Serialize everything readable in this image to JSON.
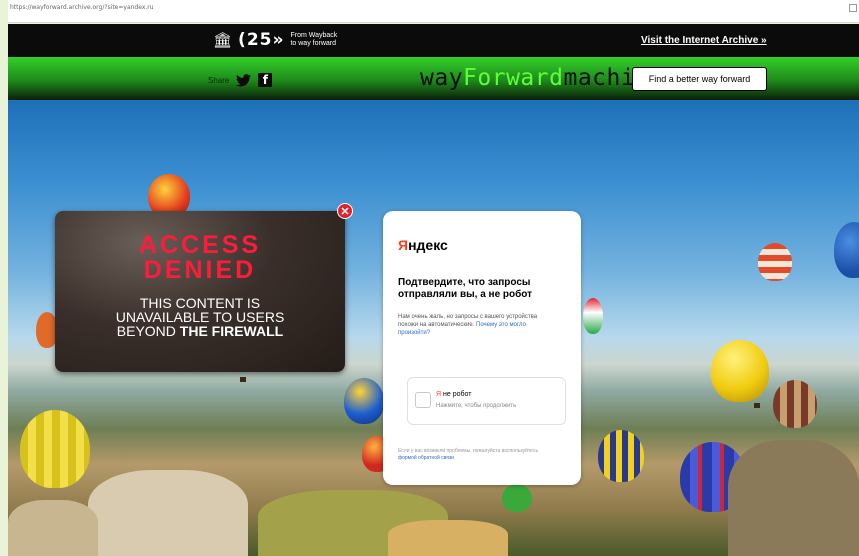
{
  "browser": {
    "url": "https://wayforward.archive.org/?site=yandex.ru"
  },
  "topbar": {
    "ia_glyph": "🏛",
    "anniversary": "(25»",
    "tagline_line1": "From Wayback",
    "tagline_line2": "to way forward",
    "visit_link": "Visit the Internet Archive »"
  },
  "greenbar": {
    "share_label": "Share",
    "twitter_icon": "twitter-icon",
    "facebook_glyph": "f",
    "logo_part1": "way",
    "logo_part2": "Forward",
    "logo_part3": "machine",
    "find_button": "Find a better way forward"
  },
  "popup": {
    "title_line1": "ACCESS",
    "title_line2": "DENIED",
    "msg_line1": "THIS CONTENT IS",
    "msg_line2": "UNAVAILABLE TO USERS",
    "msg_line3_prefix": "BEYOND ",
    "msg_line3_bold": "THE FIREWALL",
    "close_glyph": "✕"
  },
  "yandex_card": {
    "brand_first": "Я",
    "brand_rest": "ндекс",
    "heading": "Подтвердите, что запросы отправляли вы, а не робот",
    "body_text": "Нам очень жаль, но запросы с вашего устройства похожи на автоматические.",
    "body_link": "Почему это могло произойти?",
    "captcha_label_first": "Я",
    "captcha_label_rest": " не робот",
    "captcha_hint": "Нажмите, чтобы продолжить",
    "footer_text": "Если у вас возникли проблемы, пожалуйста воспользуйтесь",
    "footer_link": "формой обратной связи"
  },
  "colors": {
    "accent_green": "#34d02a",
    "logo_highlight": "#5eff3a",
    "access_denied_red": "#ff1c3b",
    "yandex_red": "#fc3f1d",
    "link_blue": "#2d6ccf"
  }
}
